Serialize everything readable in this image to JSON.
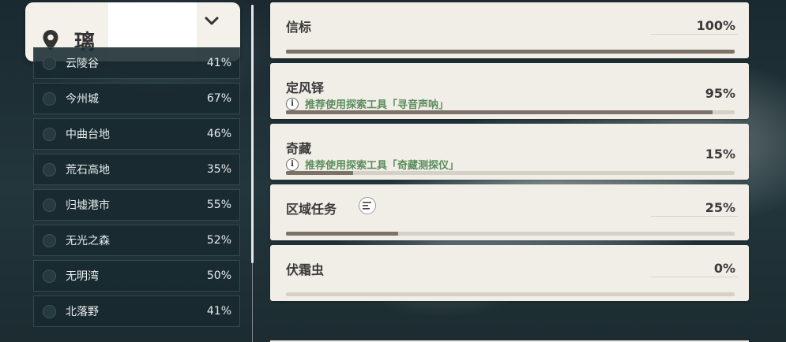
{
  "region": {
    "name": "璃"
  },
  "areas": [
    {
      "label": "云陵谷",
      "pct": "41%"
    },
    {
      "label": "今州城",
      "pct": "67%"
    },
    {
      "label": "中曲台地",
      "pct": "46%"
    },
    {
      "label": "荒石高地",
      "pct": "35%"
    },
    {
      "label": "归墟港市",
      "pct": "55%"
    },
    {
      "label": "无光之森",
      "pct": "52%"
    },
    {
      "label": "无明湾",
      "pct": "50%"
    },
    {
      "label": "北落野",
      "pct": "41%"
    }
  ],
  "stats": [
    {
      "title": "信标",
      "pct": "100%",
      "progress": 100,
      "hint": ""
    },
    {
      "title": "定风铎",
      "pct": "95%",
      "progress": 95,
      "hint": "推荐使用探索工具「寻音声呐」"
    },
    {
      "title": "奇藏",
      "pct": "15%",
      "progress": 15,
      "hint": "推荐使用探索工具「奇藏测探仪」"
    },
    {
      "title": "区域任务",
      "pct": "25%",
      "progress": 25,
      "hint": ""
    },
    {
      "title": "伏霜虫",
      "pct": "0%",
      "progress": 0,
      "hint": ""
    }
  ],
  "icons": {
    "region": "map-pin-icon",
    "dropdown": "chevron-down-icon",
    "hint": "info-icon",
    "quest": "quest-list-icon"
  }
}
